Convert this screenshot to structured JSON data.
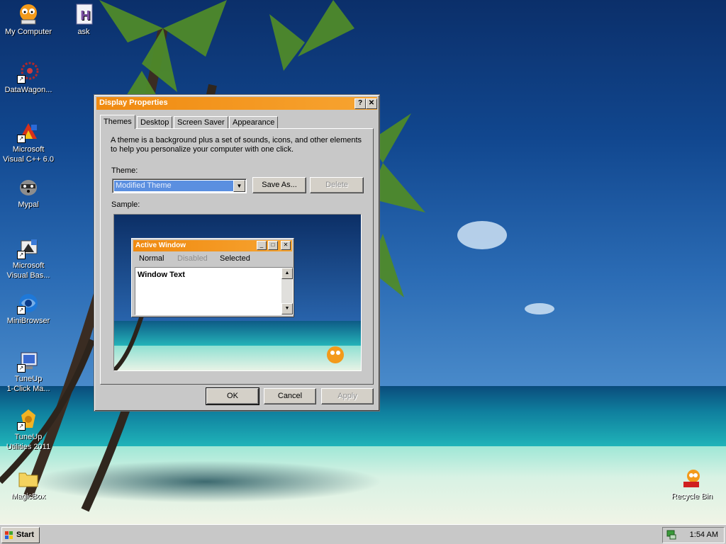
{
  "desktop": {
    "icons": [
      {
        "label": "My Computer",
        "icon": "garfield-computer-icon"
      },
      {
        "label": "ask",
        "icon": "h-document-icon"
      },
      {
        "label": "DataWagon...",
        "icon": "datawagon-icon"
      },
      {
        "label": "Microsoft\nVisual C++ 6.0",
        "icon": "visual-cpp-icon"
      },
      {
        "label": "Mypal",
        "icon": "raccoon-icon"
      },
      {
        "label": "Microsoft\nVisual Bas...",
        "icon": "visual-basic-icon"
      },
      {
        "label": "MiniBrowser",
        "icon": "globe-icon"
      },
      {
        "label": "TuneUp\n1-Click Ma...",
        "icon": "tuneup-monitor-icon"
      },
      {
        "label": "TuneUp\nUtilities 2011",
        "icon": "tuneup-utilities-icon"
      },
      {
        "label": "MagicBox",
        "icon": "folder-icon"
      },
      {
        "label": "Recycle Bin",
        "icon": "garfield-recycle-icon"
      }
    ]
  },
  "dialog": {
    "title": "Display Properties",
    "help_glyph": "?",
    "close_glyph": "✕",
    "tabs": [
      "Themes",
      "Desktop",
      "Screen Saver",
      "Appearance"
    ],
    "active_tab": "Themes",
    "description": "A theme is a background plus a set of sounds, icons, and other elements to help you personalize your computer with one click.",
    "theme_label": "Theme:",
    "theme_value": "Modified Theme",
    "save_as_label": "Save As...",
    "delete_label": "Delete",
    "sample_label": "Sample:",
    "sample": {
      "window_title": "Active Window",
      "menu_normal": "Normal",
      "menu_disabled": "Disabled",
      "menu_selected": "Selected",
      "window_text": "Window Text"
    },
    "ok_label": "OK",
    "cancel_label": "Cancel",
    "apply_label": "Apply"
  },
  "taskbar": {
    "start_label": "Start",
    "clock": "1:54 AM"
  },
  "colors": {
    "title_orange": "#f08a10",
    "face": "#c8c8c8",
    "selection": "#5b8fe0"
  }
}
